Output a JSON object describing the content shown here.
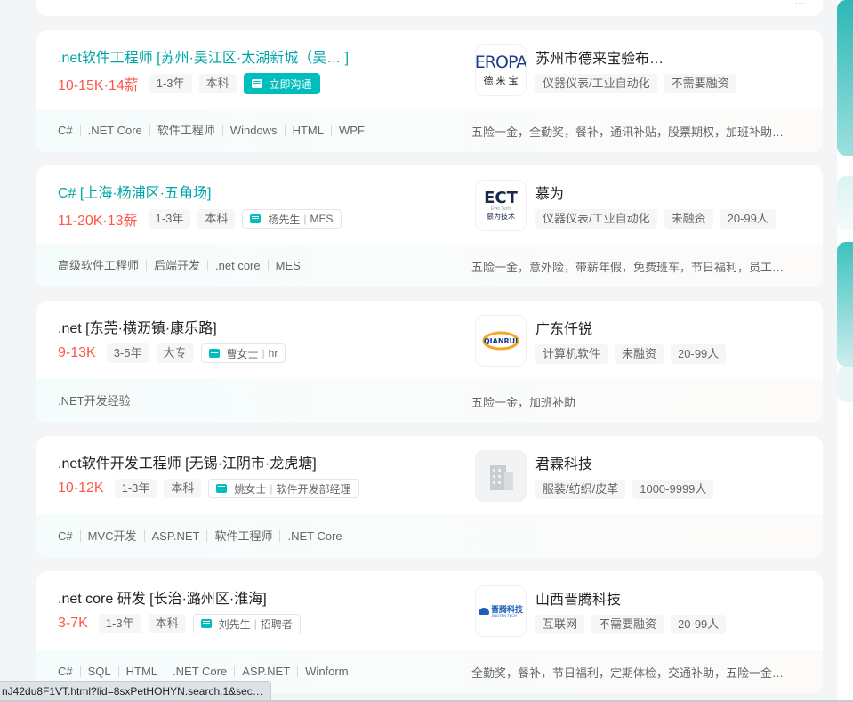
{
  "prev_card": {
    "fragment": "···"
  },
  "jobs": [
    {
      "title": ".net软件工程师  [苏州·吴江区·太湖新城（吴…  ]",
      "salary": "10-15K·14薪",
      "experience": "1-3年",
      "degree": "本科",
      "chat": {
        "label": "立即沟通"
      },
      "skills": [
        "C#",
        ".NET Core",
        "软件工程师",
        "Windows",
        "HTML",
        "WPF"
      ],
      "company": {
        "name": "苏州市德来宝验布…",
        "logo": {
          "top": "EROPA",
          "bottom": "德 来 宝"
        },
        "tags": [
          "仪器仪表/工业自动化",
          "不需要融资"
        ]
      },
      "welfare": "五险一金，全勤奖，餐补，通讯补贴，股票期权，加班补助…"
    },
    {
      "title": "C#  [上海·杨浦区·五角场]",
      "salary": "11-20K·13薪",
      "experience": "1-3年",
      "degree": "本科",
      "chat": {
        "name": "杨先生",
        "role": "MES"
      },
      "skills": [
        "高级软件工程师",
        "后端开发",
        ".net core",
        "MES"
      ],
      "company": {
        "name": "慕为",
        "logo": {
          "top": "ECT",
          "small": "Ever Tech",
          "bottom": "慕为技术"
        },
        "tags": [
          "仪器仪表/工业自动化",
          "未融资",
          "20-99人"
        ]
      },
      "welfare": "五险一金，意外险，带薪年假，免费班车，节日福利，员工…"
    },
    {
      "title": ".net  [东莞·横沥镇·康乐路]",
      "salary": "9-13K",
      "experience": "3-5年",
      "degree": "大专",
      "chat": {
        "name": "曹女士",
        "role": "hr"
      },
      "skills": [
        ".NET开发经验"
      ],
      "company": {
        "name": "广东仟锐",
        "logo": {
          "top": "QIANRUI"
        },
        "tags": [
          "计算机软件",
          "未融资",
          "20-99人"
        ]
      },
      "welfare": "五险一金，加班补助"
    },
    {
      "title": ".net软件开发工程师  [无锡·江阴市·龙虎塘]",
      "salary": "10-12K",
      "experience": "1-3年",
      "degree": "本科",
      "chat": {
        "name": "姚女士",
        "role": "软件开发部经理"
      },
      "skills": [
        "C#",
        "MVC开发",
        "ASP.NET",
        "软件工程师",
        ".NET Core"
      ],
      "company": {
        "name": "君霖科技",
        "tags": [
          "服装/纺织/皮革",
          "1000-9999人"
        ]
      },
      "welfare": ""
    },
    {
      "title": ".net core 研发  [长治·潞州区·淮海]",
      "salary": "3-7K",
      "experience": "1-3年",
      "degree": "本科",
      "chat": {
        "name": "刘先生",
        "role": "招聘者"
      },
      "skills": [
        "C#",
        "SQL",
        "HTML",
        ".NET Core",
        "ASP.NET",
        "Winform"
      ],
      "company": {
        "name": "山西晋腾科技",
        "logo": {
          "top": "晋腾科技",
          "small": "JINGTEN TECH"
        },
        "tags": [
          "互联网",
          "不需要融资",
          "20-99人"
        ]
      },
      "welfare": "全勤奖，餐补，节日福利，定期体检，交通补助，五险一金…"
    }
  ],
  "status_bar": {
    "url": "nJ42du8F1VT.html?lid=8sxPetHOHYN.search.1&sec…"
  },
  "colors": {
    "accent": "#00bebd",
    "salary": "#fe574a",
    "title_hover": "#00a6a7"
  }
}
